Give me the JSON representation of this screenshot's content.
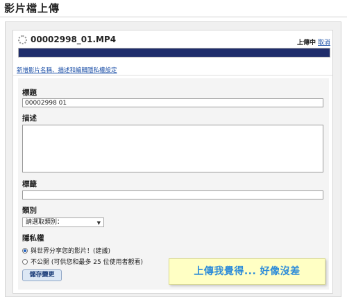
{
  "page": {
    "title": "影片檔上傳"
  },
  "upload": {
    "file_name": "00002998_01.MP4",
    "status": "上傳中",
    "cancel_label": "取消",
    "progress": 1.0
  },
  "details_link": "新增影片名稱、描述和編輯隱私權設定",
  "form": {
    "title_label": "標題",
    "title_value": "00002998 01",
    "description_label": "描述",
    "description_value": "",
    "tags_label": "標籤",
    "tags_value": "",
    "category_label": "類別",
    "category_selected": "請選取類別：",
    "privacy_label": "隱私權",
    "privacy_options": [
      "與世界分享您的影片！(建議)",
      "不公開 (可供您和最多 25 位使用者觀看)"
    ],
    "privacy_selected_index": 0,
    "save_label": "儲存變更"
  },
  "callout": {
    "text": "上傳我覺得...  好像沒差"
  },
  "colors": {
    "progress_fill": "#1f2d6b",
    "link": "#1b4fa7",
    "callout_bg": "#ffffc4",
    "callout_text": "#2d8cd9"
  }
}
